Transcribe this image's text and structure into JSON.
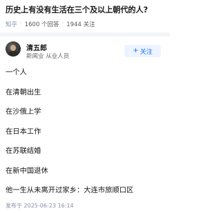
{
  "question": {
    "title": "历史上有没有生活在三个及以上朝代的人?",
    "source": "知乎",
    "answers_count": "1600 个回答",
    "followers_count": "1944 关注"
  },
  "author": {
    "name": "清五郎",
    "bio": "新闻业 从业人员",
    "follow_label": "关注",
    "follow_icon": "plus-icon"
  },
  "answer": {
    "paragraphs": [
      "一个人",
      "在清朝出生",
      "在沙俄上学",
      "在日本工作",
      "在苏联结婚",
      "在新中国退休",
      "他一生从未离开过家乡：大连市旅顺口区"
    ]
  },
  "publish": {
    "text": "发布于 2025-06-23 16:14"
  },
  "colors": {
    "accent": "#1772f6",
    "follow_bg": "#eef4ff",
    "meta": "#8590a6"
  }
}
